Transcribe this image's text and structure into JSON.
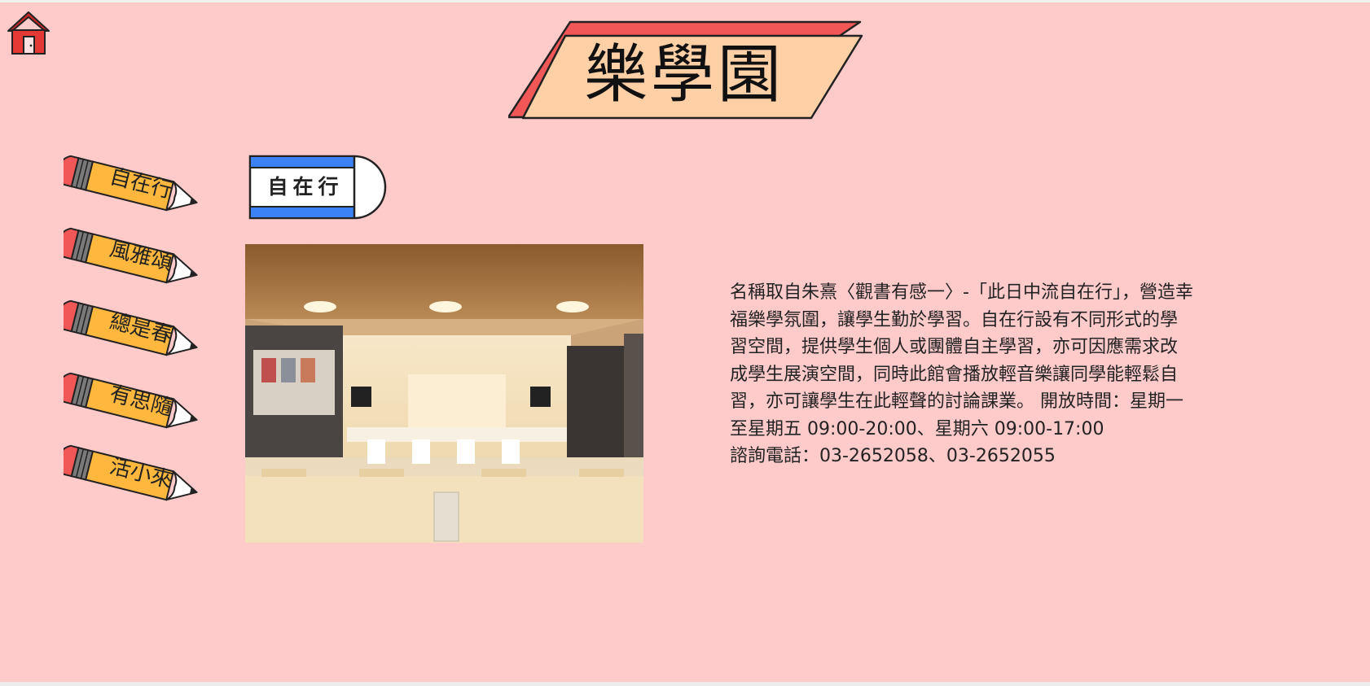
{
  "header": {
    "title": "樂學園",
    "home_icon": "house-icon"
  },
  "sidebar": {
    "items": [
      {
        "label": "自在行",
        "icon": "pencil-icon"
      },
      {
        "label": "風雅頌",
        "icon": "pencil-icon"
      },
      {
        "label": "總是春",
        "icon": "pencil-icon"
      },
      {
        "label": "有思隨",
        "icon": "pencil-icon"
      },
      {
        "label": "活小來",
        "icon": "pencil-icon"
      }
    ]
  },
  "main": {
    "section_label": "自在行",
    "photo_subject": "study-space-photo",
    "description": "名稱取自朱熹〈觀書有感一〉-「此日中流自在行」，營造幸福樂學氛圍，讓學生勤於學習。自在行設有不同形式的學習空間，提供學生個人或團體自主學習，亦可因應需求改成學生展演空間，同時此館會播放輕音樂讓同學能輕鬆自習，亦可讓學生在此輕聲的討論課業。 開放時間：星期一至星期五 09:00-20:00、星期六 09:00-17:00",
    "contact": "諮詢電話：03-2652058、03-2652055"
  },
  "colors": {
    "background": "#ffcaca",
    "banner_back": "#f25757",
    "banner_front": "#ffcfa6",
    "pencil_body": "#ffb73d",
    "pencil_eraser": "#f25757",
    "eraser_stripe": "#3b82f6"
  }
}
